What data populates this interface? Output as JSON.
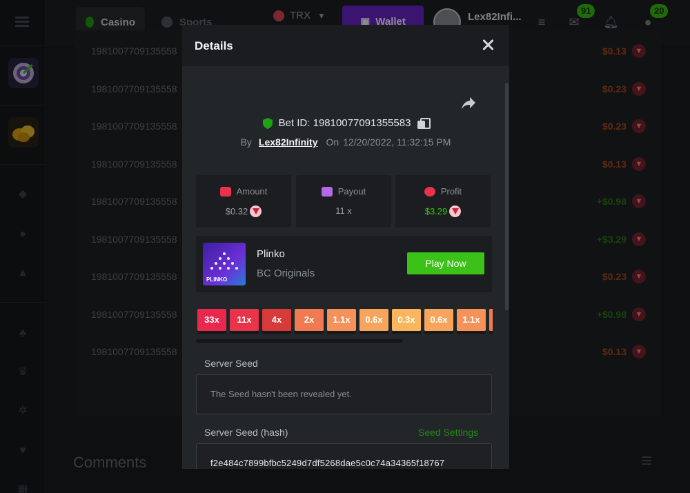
{
  "topbar": {
    "tab_casino": "Casino",
    "tab_sports": "Sports",
    "currency": "TRX",
    "wallet_label": "Wallet",
    "username": "Lex82Infi...",
    "mail_badge": "91",
    "chat_badge": "20"
  },
  "background_list": {
    "rows": [
      {
        "id": "1981007709135558",
        "value": "$0.13",
        "sign": "neg"
      },
      {
        "id": "1981007709135558",
        "value": "$0.23",
        "sign": "neg"
      },
      {
        "id": "1981007709135558",
        "value": "$0.23",
        "sign": "neg"
      },
      {
        "id": "1981007709135558",
        "value": "$0.13",
        "sign": "neg"
      },
      {
        "id": "1981007709135558",
        "value": "+$0.98",
        "sign": "pos"
      },
      {
        "id": "1981007709135558",
        "value": "+$3.29",
        "sign": "pos"
      },
      {
        "id": "1981007709135558",
        "value": "$0.23",
        "sign": "neg"
      },
      {
        "id": "1981007709135558",
        "value": "+$0.98",
        "sign": "pos"
      },
      {
        "id": "1981007709135558",
        "value": "$0.13",
        "sign": "neg"
      }
    ],
    "comments_title": "Comments"
  },
  "modal": {
    "title": "Details",
    "bet_id": "Bet ID: 19810077091355583",
    "by_label": "By",
    "username": "Lex82Infinity",
    "on_label": "On",
    "datetime": "12/20/2022, 11:32:15 PM",
    "stats": {
      "amount_label": "Amount",
      "amount_value": "$0.32",
      "payout_label": "Payout",
      "payout_value": "11 x",
      "profit_label": "Profit",
      "profit_value": "$3.29"
    },
    "game": {
      "name": "Plinko",
      "provider": "BC Originals",
      "thumb_text": "PLINKO",
      "play_label": "Play Now"
    },
    "multipliers": [
      {
        "label": "33x",
        "color": "#e8284d"
      },
      {
        "label": "11x",
        "color": "#e8344a"
      },
      {
        "label": "4x",
        "color": "#d63a3a"
      },
      {
        "label": "2x",
        "color": "#f07a52"
      },
      {
        "label": "1.1x",
        "color": "#f59259"
      },
      {
        "label": "0.6x",
        "color": "#f7a55c"
      },
      {
        "label": "0.3x",
        "color": "#f9b65c"
      },
      {
        "label": "0.6x",
        "color": "#f7a55c"
      },
      {
        "label": "1.1x",
        "color": "#f59259"
      }
    ],
    "server_seed_label": "Server Seed",
    "server_seed_value": "The Seed hasn't been revealed yet.",
    "server_seed_hash_label": "Server Seed (hash)",
    "seed_settings_label": "Seed Settings",
    "server_seed_hash_value": "f2e484c7899bfbc5249d7df5268dae5c0c74a34365f18767"
  },
  "colors": {
    "accent_green": "#3bc117",
    "wallet_purple": "#6a26cc",
    "negative": "#b24b1e",
    "positive": "#2a7a18",
    "profit_green": "#3bc117"
  }
}
